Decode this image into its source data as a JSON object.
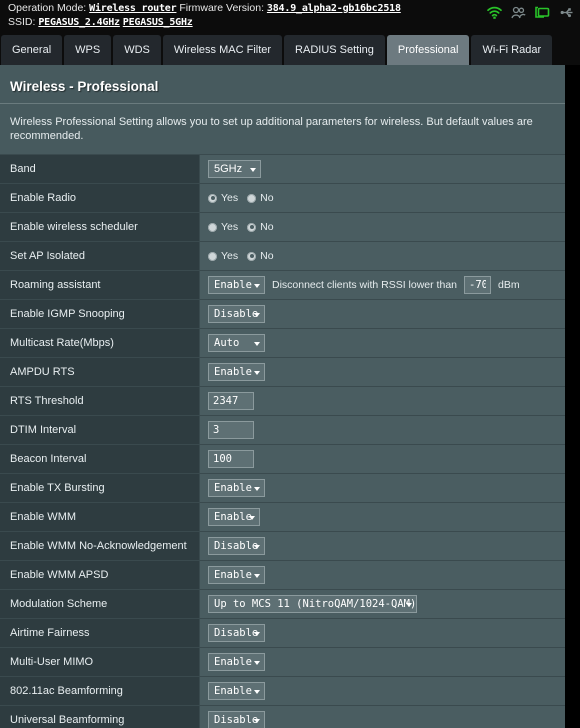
{
  "topbar": {
    "operation_mode_label": "Operation Mode:",
    "operation_mode_value": "Wireless router",
    "firmware_label": "Firmware Version:",
    "firmware_value": "384.9_alpha2-gb16bc2518",
    "ssid_label": "SSID:",
    "ssid_1": "PEGASUS_2.4GHz",
    "ssid_2": "PEGASUS_5GHz",
    "icons": [
      "wifi-icon",
      "clients-icon",
      "network-map-icon",
      "usb-icon"
    ],
    "icon_colors": {
      "active": "#29c329",
      "inactive": "#7e8a8c"
    }
  },
  "tabs": [
    {
      "label": "General",
      "active": false
    },
    {
      "label": "WPS",
      "active": false
    },
    {
      "label": "WDS",
      "active": false
    },
    {
      "label": "Wireless MAC Filter",
      "active": false
    },
    {
      "label": "RADIUS Setting",
      "active": false
    },
    {
      "label": "Professional",
      "active": true
    },
    {
      "label": "Wi-Fi Radar",
      "active": false
    }
  ],
  "page": {
    "title": "Wireless - Professional",
    "description": "Wireless Professional Setting allows you to set up additional parameters for wireless. But default values are recommended."
  },
  "radio_options": {
    "yes": "Yes",
    "no": "No"
  },
  "rows": [
    {
      "label": "Band",
      "type": "select-sans",
      "value": "5GHz",
      "width": "w-band"
    },
    {
      "label": "Enable Radio",
      "type": "radio",
      "selected": "yes"
    },
    {
      "label": "Enable wireless scheduler",
      "type": "radio",
      "selected": "no"
    },
    {
      "label": "Set AP Isolated",
      "type": "radio",
      "selected": "no"
    },
    {
      "label": "Roaming assistant",
      "type": "select-with-rssi",
      "value": "Enable",
      "width": "w-std",
      "rssi_text": "Disconnect clients with RSSI lower than",
      "rssi_value": "-70",
      "rssi_unit": "dBm"
    },
    {
      "label": "Enable IGMP Snooping",
      "type": "select",
      "value": "Disable",
      "width": "w-std"
    },
    {
      "label": "Multicast Rate(Mbps)",
      "type": "select",
      "value": "Auto",
      "width": "w-std"
    },
    {
      "label": "AMPDU RTS",
      "type": "select",
      "value": "Enable",
      "width": "w-std"
    },
    {
      "label": "RTS Threshold",
      "type": "text",
      "value": "2347"
    },
    {
      "label": "DTIM Interval",
      "type": "text",
      "value": "3"
    },
    {
      "label": "Beacon Interval",
      "type": "text",
      "value": "100"
    },
    {
      "label": "Enable TX Bursting",
      "type": "select",
      "value": "Enable",
      "width": "w-std"
    },
    {
      "label": "Enable WMM",
      "type": "select",
      "value": "Enable",
      "width": "w-narrow"
    },
    {
      "label": "Enable WMM No-Acknowledgement",
      "type": "select",
      "value": "Disable",
      "width": "w-std"
    },
    {
      "label": "Enable WMM APSD",
      "type": "select",
      "value": "Enable",
      "width": "w-std"
    },
    {
      "label": "Modulation Scheme",
      "type": "select",
      "value": "Up to MCS 11 (NitroQAM/1024-QAM)",
      "width": "w-mod"
    },
    {
      "label": "Airtime Fairness",
      "type": "select",
      "value": "Disable",
      "width": "w-std"
    },
    {
      "label": "Multi-User MIMO",
      "type": "select",
      "value": "Enable",
      "width": "w-std"
    },
    {
      "label": "802.11ac Beamforming",
      "type": "select",
      "value": "Enable",
      "width": "w-std"
    },
    {
      "label": "Universal Beamforming",
      "type": "select",
      "value": "Disable",
      "width": "w-std"
    }
  ]
}
